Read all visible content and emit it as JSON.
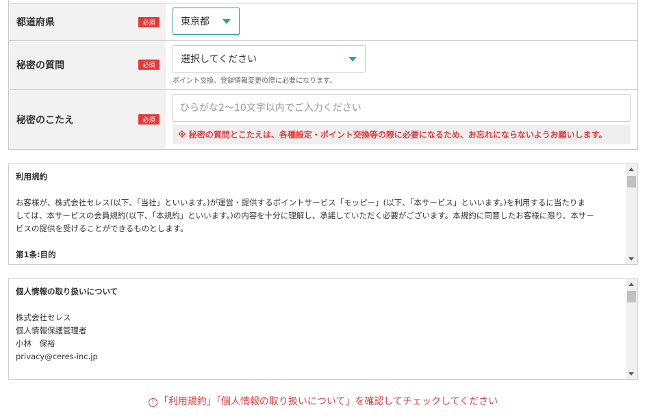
{
  "form": {
    "prefecture": {
      "label": "都道府県",
      "required": "必須",
      "value": "東京都"
    },
    "secret_question": {
      "label": "秘密の質問",
      "required": "必須",
      "value": "選択してください",
      "hint": "ポイント交換、登録情報変更の際に必要になります。"
    },
    "secret_answer": {
      "label": "秘密のこたえ",
      "required": "必須",
      "value": "",
      "placeholder": "ひらがな2〜10文字以内でご入力ください",
      "note": "※ 秘密の質問とこたえは、各種設定・ポイント交換等の際に必要になるため、お忘れにならないようお願いします。"
    }
  },
  "terms": {
    "title": "利用規約",
    "paragraph_lines": [
      "お客様が、株式会社セレス(以下、「当社」といいます。)が運営・提供するポイントサービス「モッピー」(以下、「本サービス」といいます。)を利用するに当たりま",
      "しては、本サービスの会員規約(以下、「本規約」といいます。)の内容を十分に理解し、承諾していただく必要がございます。本規約に同意したお客様に限り、本サー",
      "ビスの提供を受けることができるものとします。"
    ],
    "section_1": "第1条:目的"
  },
  "privacy": {
    "title": "個人情報の取り扱いについて",
    "lines": [
      "株式会社セレス",
      "個人情報保護管理者",
      "小林　保裕",
      "privacy@ceres-inc.jp"
    ]
  },
  "error": {
    "icon": "!",
    "message": "「利用規約」「個人情報の取り扱いについて」を確認してチェックしてください"
  },
  "colors": {
    "accent": "#2ba195",
    "required_badge": "#e63a3a",
    "error": "#e33b3b"
  }
}
